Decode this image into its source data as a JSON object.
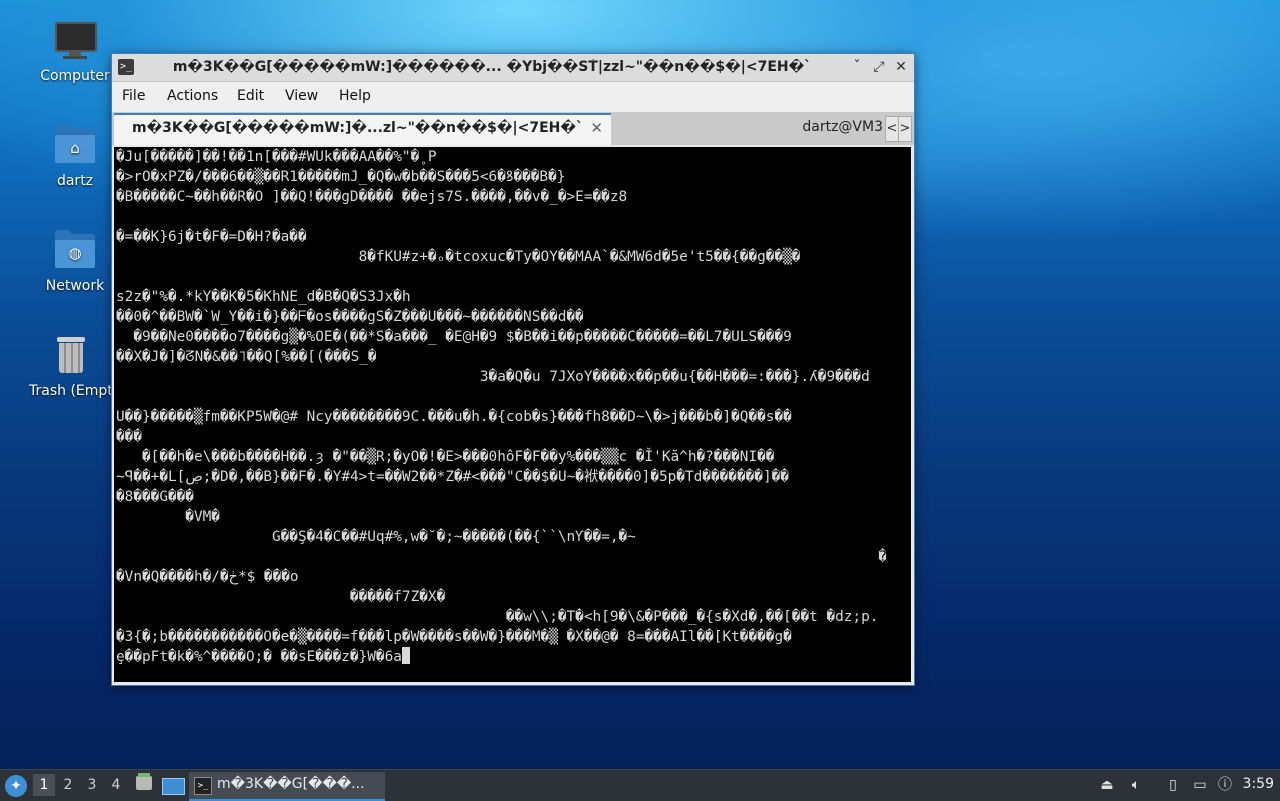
{
  "desktop": {
    "icons": [
      {
        "label": "Computer",
        "icon": "computer-icon"
      },
      {
        "label": "dartz",
        "icon": "home-folder-icon"
      },
      {
        "label": "Network",
        "icon": "network-folder-icon"
      },
      {
        "label": "Trash (Empty)",
        "icon": "trash-icon"
      }
    ]
  },
  "window": {
    "title": "m�3K��G[�����mW:]������... �Ybj��SṪ|zzl~\"��n��$�|<7EH�`",
    "controls": {
      "minimize": "ˇ",
      "maximize": "⤢",
      "close": "✕"
    },
    "menu": [
      "File",
      "Actions",
      "Edit",
      "View",
      "Help"
    ],
    "tabs": [
      {
        "title": "m�3K��G[�����mW:]�...zl~\"��n��$�|<7EH�`",
        "active": true
      },
      {
        "title": "dartz@VM3",
        "active": false
      }
    ],
    "tab_scroll": {
      "left": "<",
      "right": ">"
    }
  },
  "terminal": {
    "lines": [
      "�Ju[�����]��!��1n[���#WUk���AA��%\"�˳P",
      "�>rO�xPZ�/���6��▒��R1�����mJ_�Q�w�b��S���5<6�ꝸ���B�}",
      "�B�����C~��h��R�O ]��Q!���gD���� ��ejs7S.����,��v�_�>E=��z8",
      "                                                                                                                       F[-��Q������鸓����",
      "�=��K}6j�t�F�=D�H?�a��",
      "                            8�fKU#z+�ₒ�tcoxuc�Ty�OY��MAA`�&MW6d�5e't5��{��g��▒�",
      "                                                                                                                                              ▒�|�",
      "s2z�\"%�.*kY��K�5�KhNE_d�B�Q�S3Jx�h",
      "��0�^��BW�`W_Y��i�}��ᖴ�os����gS�Z���U���~������NS��d��",
      "  �9��Ne0����o7����g▒�%OE�(��*S�a���_ �E@H�9 $�B��i��p�����C�����=��L7�ULS���9",
      "��X�J�]�ᘔN�&��˥��Q[%��[(���S_�",
      "                                          3�a�Q�u 7JXoY����x��p��u{��H���=:���}.ʎ�9���d",
      "                                                                                                                                                       ��",
      "U��}�����▒fm��KP5W�@# Ncy��������9C.���u�h.�{cob�s}���fh8��D~\\�>j���b�]�Q��s��",
      "���",
      "   �[��h�e\\���b����H��.ȝ �\"��▒R;�yO�!�E>���0hôF�F��y%���▒▒c �Ǐ'Kă^h�?���NI��",
      "~ꟼ��+�L[ڝ;�D�,��B}��F�.�Y#4>t=��W2��*Z�#<���\"C��$�U~�袱����0]�5p�Td�������]��",
      "�8���G���",
      "        �VM�",
      "                  G��Ş�4�C��#Uq#%,w�˘�;~�����(��{``\\nƳ��=,�~",
      "                                                                                        ��Np�M��x�,W��ᓫ�>>��",
      "�Vn�Q����h�/�ڂ*$ ���o",
      "                           �����f7Z�X�",
      "                                             ��w\\\\;�T�<h[9�\\&�P���_�{s�Xd�,��[��t �dz;p.",
      "�3{�;b�����������O�e�▒����=f���lp�W����s��W�}���M�▒ �X��@� 8=���AIl��[Kt����g�",
      "ȩ��pFt�k�%^����O;� ��sE���z�}W�6a"
    ]
  },
  "taskbar": {
    "workspaces": [
      "1",
      "2",
      "3",
      "4"
    ],
    "active_workspace": "1",
    "task_label": "m�3K��G[���...",
    "clock": "3:59"
  }
}
